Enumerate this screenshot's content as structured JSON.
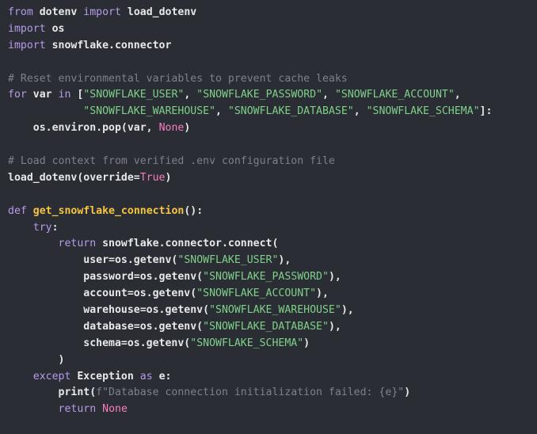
{
  "editor": {
    "language": "python",
    "colors": {
      "background": "#2b2d34",
      "keyword": "#b79bea",
      "string": "#7fd08a",
      "constant": "#f47ec0",
      "function": "#f5c542",
      "comment": "#7d818c",
      "identifier": "#e8e8ea"
    },
    "lines": [
      [
        {
          "t": "kw",
          "v": "from"
        },
        {
          "t": "id",
          "v": " dotenv "
        },
        {
          "t": "kw",
          "v": "import"
        },
        {
          "t": "id",
          "v": " load_dotenv"
        }
      ],
      [
        {
          "t": "kw",
          "v": "import"
        },
        {
          "t": "id",
          "v": " os"
        }
      ],
      [
        {
          "t": "kw",
          "v": "import"
        },
        {
          "t": "id",
          "v": " snowflake.connector"
        }
      ],
      [],
      [
        {
          "t": "cm",
          "v": "# Reset environmental variables to prevent cache leaks"
        }
      ],
      [
        {
          "t": "kw",
          "v": "for"
        },
        {
          "t": "id",
          "v": " var "
        },
        {
          "t": "kw",
          "v": "in"
        },
        {
          "t": "id",
          "v": " ["
        },
        {
          "t": "str",
          "v": "\"SNOWFLAKE_USER\""
        },
        {
          "t": "id",
          "v": ", "
        },
        {
          "t": "str",
          "v": "\"SNOWFLAKE_PASSWORD\""
        },
        {
          "t": "id",
          "v": ", "
        },
        {
          "t": "str",
          "v": "\"SNOWFLAKE_ACCOUNT\""
        },
        {
          "t": "id",
          "v": ","
        }
      ],
      [
        {
          "t": "id",
          "v": "            "
        },
        {
          "t": "str",
          "v": "\"SNOWFLAKE_WAREHOUSE\""
        },
        {
          "t": "id",
          "v": ", "
        },
        {
          "t": "str",
          "v": "\"SNOWFLAKE_DATABASE\""
        },
        {
          "t": "id",
          "v": ", "
        },
        {
          "t": "str",
          "v": "\"SNOWFLAKE_SCHEMA\""
        },
        {
          "t": "id",
          "v": "]:"
        }
      ],
      [
        {
          "t": "id",
          "v": "    os.environ.pop(var, "
        },
        {
          "t": "const",
          "v": "None"
        },
        {
          "t": "id",
          "v": ")"
        }
      ],
      [],
      [
        {
          "t": "cm",
          "v": "# Load context from verified .env configuration file"
        }
      ],
      [
        {
          "t": "id",
          "v": "load_dotenv(override="
        },
        {
          "t": "const",
          "v": "True"
        },
        {
          "t": "id",
          "v": ")"
        }
      ],
      [],
      [
        {
          "t": "kw",
          "v": "def"
        },
        {
          "t": "id",
          "v": " "
        },
        {
          "t": "fn",
          "v": "get_snowflake_connection"
        },
        {
          "t": "id",
          "v": "():"
        }
      ],
      [
        {
          "t": "id",
          "v": "    "
        },
        {
          "t": "kw",
          "v": "try"
        },
        {
          "t": "id",
          "v": ":"
        }
      ],
      [
        {
          "t": "id",
          "v": "        "
        },
        {
          "t": "kw",
          "v": "return"
        },
        {
          "t": "id",
          "v": " snowflake.connector.connect("
        }
      ],
      [
        {
          "t": "id",
          "v": "            user=os.getenv("
        },
        {
          "t": "str",
          "v": "\"SNOWFLAKE_USER\""
        },
        {
          "t": "id",
          "v": "),"
        }
      ],
      [
        {
          "t": "id",
          "v": "            password=os.getenv("
        },
        {
          "t": "str",
          "v": "\"SNOWFLAKE_PASSWORD\""
        },
        {
          "t": "id",
          "v": "),"
        }
      ],
      [
        {
          "t": "id",
          "v": "            account=os.getenv("
        },
        {
          "t": "str",
          "v": "\"SNOWFLAKE_ACCOUNT\""
        },
        {
          "t": "id",
          "v": "),"
        }
      ],
      [
        {
          "t": "id",
          "v": "            warehouse=os.getenv("
        },
        {
          "t": "str",
          "v": "\"SNOWFLAKE_WAREHOUSE\""
        },
        {
          "t": "id",
          "v": "),"
        }
      ],
      [
        {
          "t": "id",
          "v": "            database=os.getenv("
        },
        {
          "t": "str",
          "v": "\"SNOWFLAKE_DATABASE\""
        },
        {
          "t": "id",
          "v": "),"
        }
      ],
      [
        {
          "t": "id",
          "v": "            schema=os.getenv("
        },
        {
          "t": "str",
          "v": "\"SNOWFLAKE_SCHEMA\""
        },
        {
          "t": "id",
          "v": ")"
        }
      ],
      [
        {
          "t": "id",
          "v": "        )"
        }
      ],
      [
        {
          "t": "id",
          "v": "    "
        },
        {
          "t": "kw",
          "v": "except"
        },
        {
          "t": "id",
          "v": " Exception "
        },
        {
          "t": "kw",
          "v": "as"
        },
        {
          "t": "id",
          "v": " e:"
        }
      ],
      [
        {
          "t": "id",
          "v": "        print("
        },
        {
          "t": "cm",
          "v": "f\"Database connection initialization failed: {e}\""
        },
        {
          "t": "id",
          "v": ")"
        }
      ],
      [
        {
          "t": "id",
          "v": "        "
        },
        {
          "t": "kw",
          "v": "return"
        },
        {
          "t": "id",
          "v": " "
        },
        {
          "t": "const",
          "v": "None"
        }
      ]
    ]
  }
}
